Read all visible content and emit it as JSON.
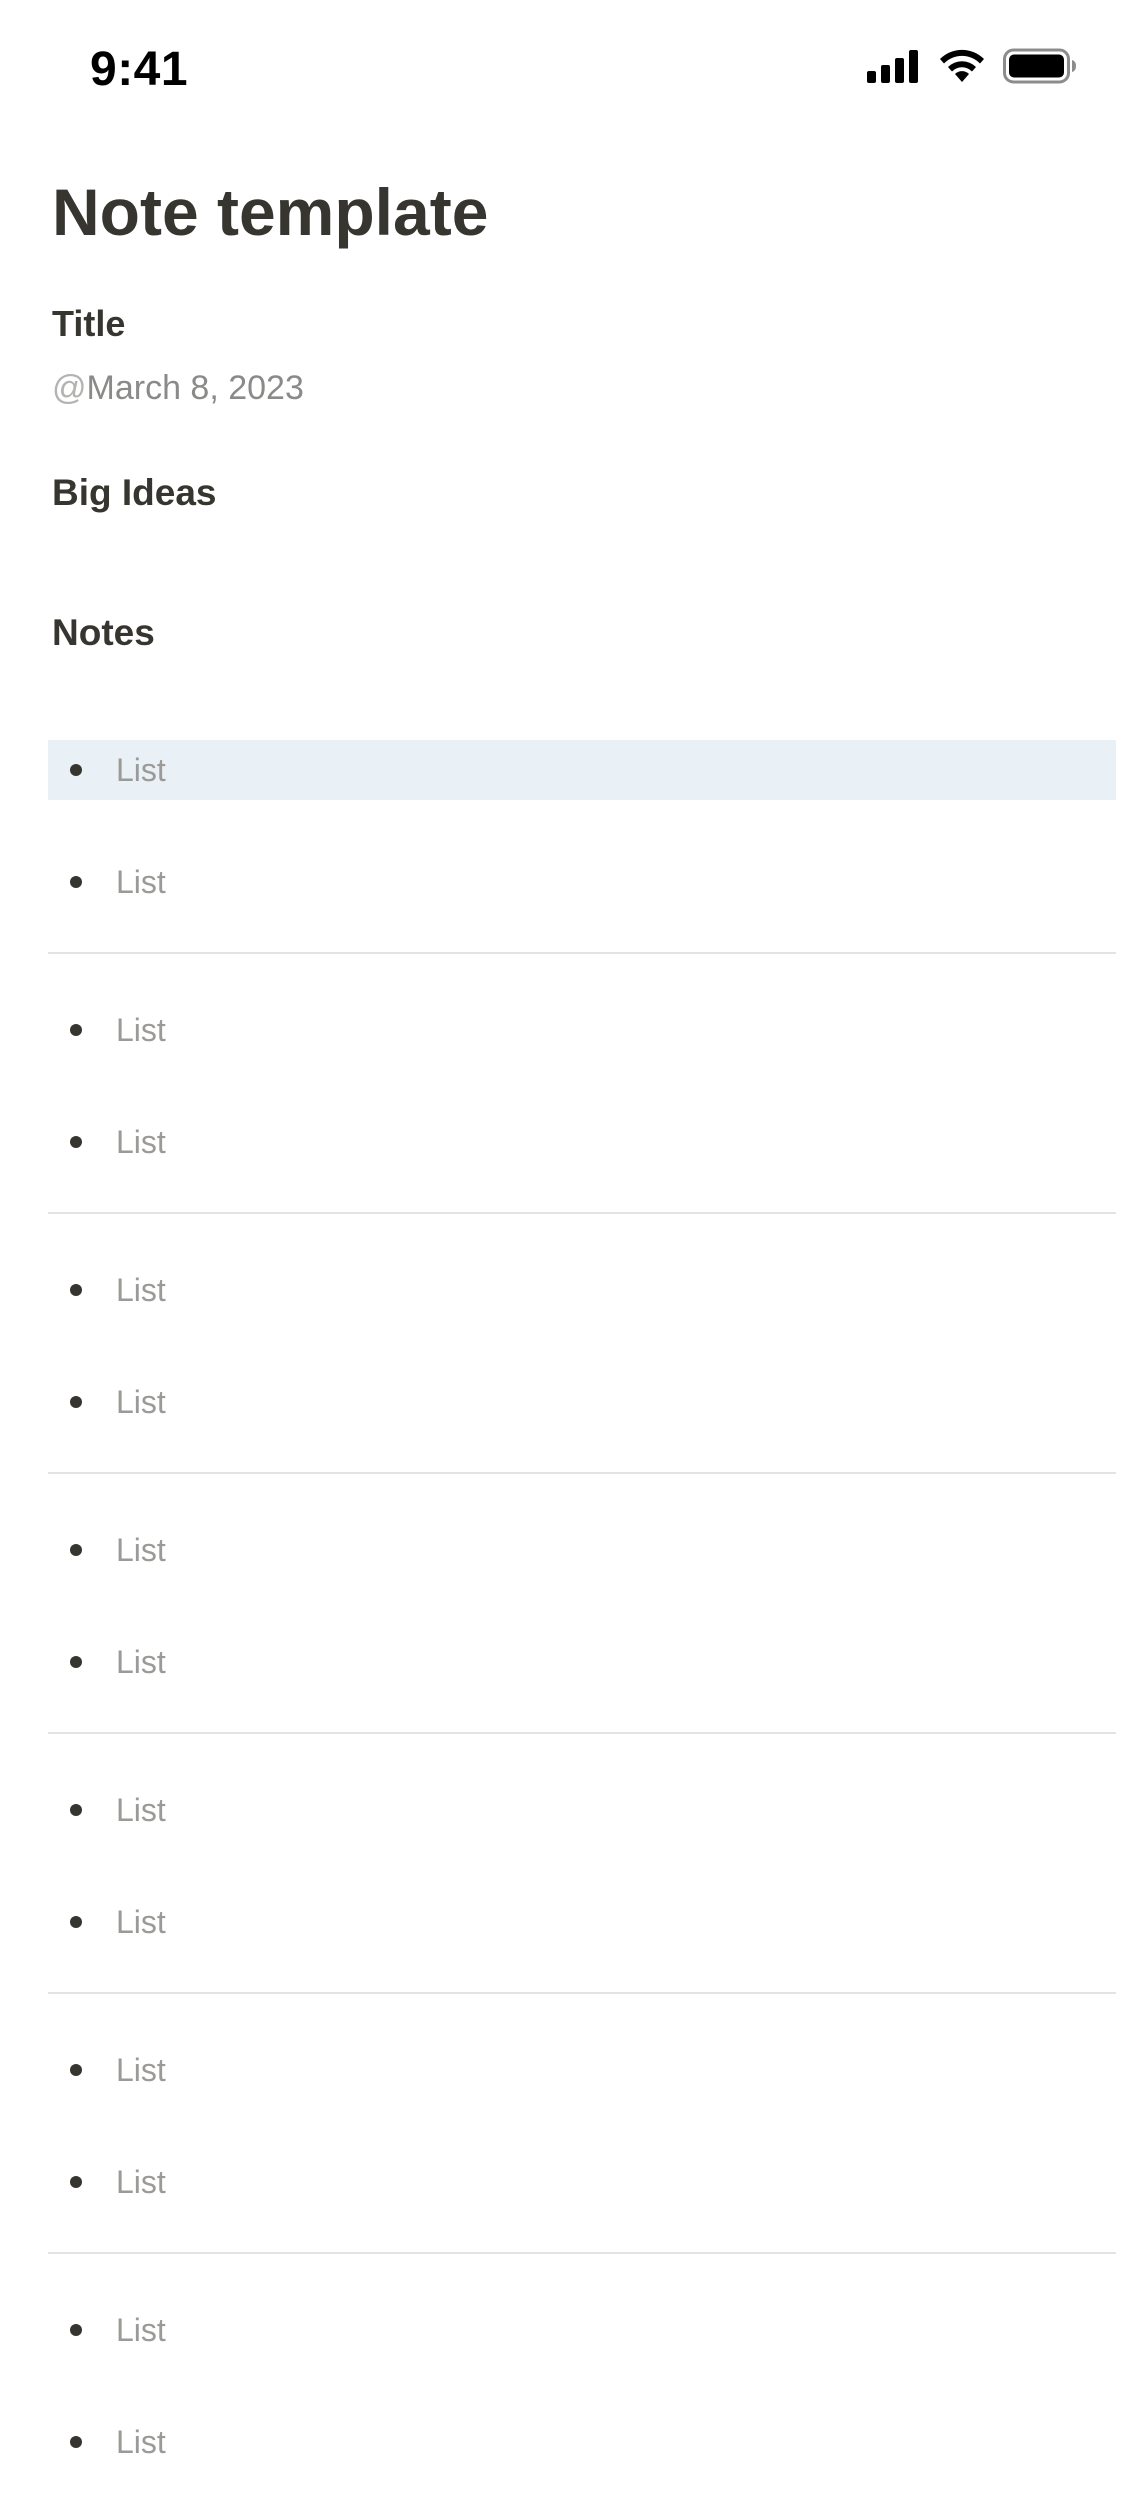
{
  "status_bar": {
    "time": "9:41",
    "icons": [
      "cellular-signal-icon",
      "wifi-icon",
      "battery-icon"
    ]
  },
  "page": {
    "title": "Note template",
    "title_label": "Title",
    "date_prefix": "@",
    "date": "March 8, 2023",
    "section_big_ideas": "Big Ideas",
    "section_notes": "Notes"
  },
  "list_groups": [
    {
      "items": [
        "List",
        "List"
      ],
      "selected_index": 0
    },
    {
      "items": [
        "List",
        "List"
      ]
    },
    {
      "items": [
        "List",
        "List"
      ]
    },
    {
      "items": [
        "List",
        "List"
      ]
    },
    {
      "items": [
        "List",
        "List"
      ]
    },
    {
      "items": [
        "List",
        "List"
      ]
    },
    {
      "items": [
        "List",
        "List"
      ]
    }
  ],
  "colors": {
    "text_primary": "#37352f",
    "text_placeholder": "#9b9a97",
    "selected_row_bg": "#e9f1f6",
    "divider": "#e3e3e1"
  }
}
